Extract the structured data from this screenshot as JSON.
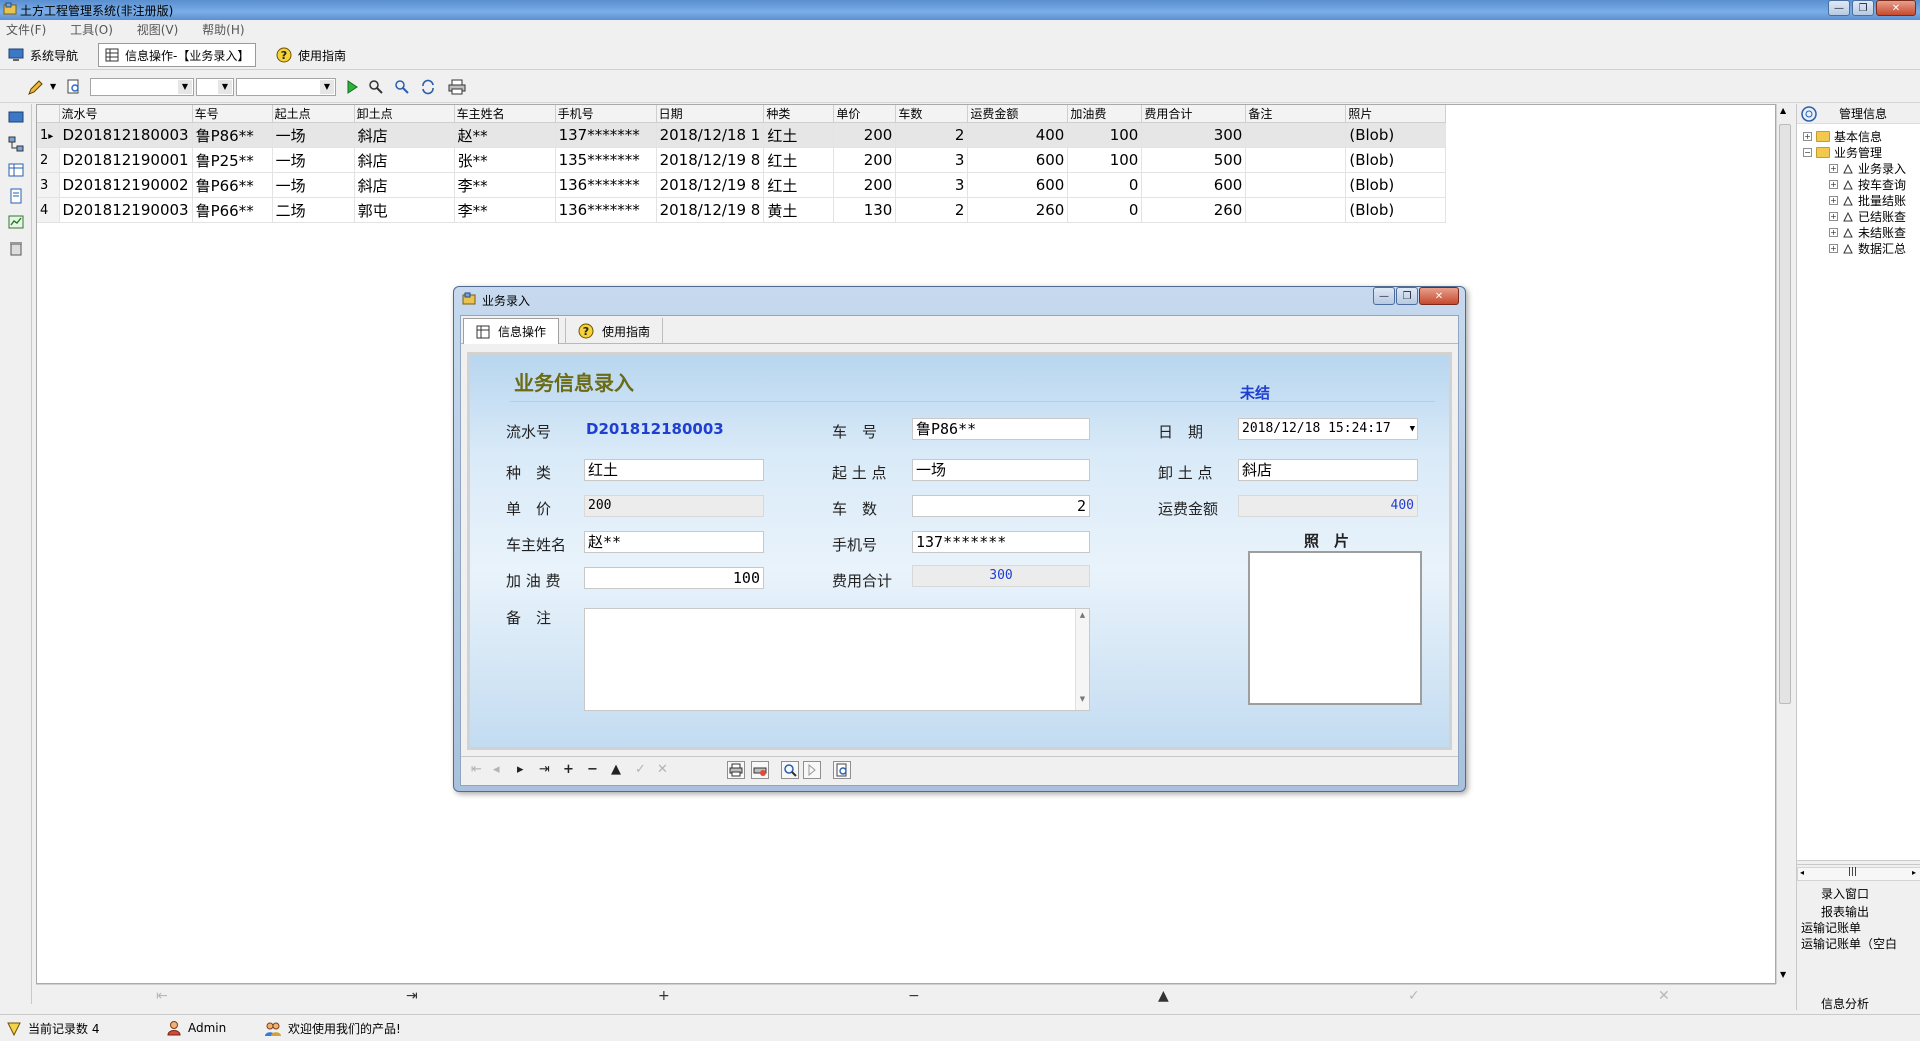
{
  "window": {
    "title": "土方工程管理系统(非注册版)",
    "controls": [
      "—",
      "❐",
      "✕"
    ]
  },
  "menu": [
    "文件(F)",
    "工具(O)",
    "视图(V)",
    "帮助(H)"
  ],
  "nav_tabs": [
    {
      "label": "系统导航",
      "icon": "monitor-icon"
    },
    {
      "label": "信息操作-【业务录入】",
      "icon": "grid-icon"
    },
    {
      "label": "使用指南",
      "icon": "help-icon"
    }
  ],
  "grid": {
    "columns": [
      "流水号",
      "车号",
      "起土点",
      "卸土点",
      "车主姓名",
      "手机号",
      "日期",
      "种类",
      "单价",
      "车数",
      "运费金额",
      "加油费",
      "费用合计",
      "备注",
      "照片"
    ],
    "rows": [
      {
        "idx": "1",
        "cells": [
          "D201812180003",
          "鲁P86**",
          "一场",
          "斜店",
          "赵**",
          "137*******",
          "2018/12/18 1",
          "红土",
          "200",
          "2",
          "400",
          "100",
          "300",
          "",
          "(Blob)"
        ]
      },
      {
        "idx": "2",
        "cells": [
          "D201812190001",
          "鲁P25**",
          "一场",
          "斜店",
          "张**",
          "135*******",
          "2018/12/19 8",
          "红土",
          "200",
          "3",
          "600",
          "100",
          "500",
          "",
          "(Blob)"
        ]
      },
      {
        "idx": "3",
        "cells": [
          "D201812190002",
          "鲁P66**",
          "一场",
          "斜店",
          "李**",
          "136*******",
          "2018/12/19 8",
          "红土",
          "200",
          "3",
          "600",
          "0",
          "600",
          "",
          "(Blob)"
        ]
      },
      {
        "idx": "4",
        "cells": [
          "D201812190003",
          "鲁P66**",
          "二场",
          "郭屯",
          "李**",
          "136*******",
          "2018/12/19 8",
          "黄土",
          "130",
          "2",
          "260",
          "0",
          "260",
          "",
          "(Blob)"
        ]
      }
    ],
    "selected_row": 0,
    "current_marker": "▸"
  },
  "grid_nav": [
    "⇤",
    "⇥",
    "+",
    "−",
    "▲",
    "✓",
    "✕"
  ],
  "right_panel": {
    "header": "管理信息",
    "tree": [
      {
        "label": "基本信息",
        "level": 0,
        "expander": "+",
        "kind": "folder"
      },
      {
        "label": "业务管理",
        "level": 0,
        "expander": "−",
        "kind": "folder"
      },
      {
        "label": "业务录入",
        "level": 1,
        "expander": "+",
        "kind": "doc"
      },
      {
        "label": "按车查询",
        "level": 1,
        "expander": "+",
        "kind": "doc"
      },
      {
        "label": "批量结账",
        "level": 1,
        "expander": "+",
        "kind": "doc"
      },
      {
        "label": "已结账查",
        "level": 1,
        "expander": "+",
        "kind": "doc"
      },
      {
        "label": "未结账查",
        "level": 1,
        "expander": "+",
        "kind": "doc"
      },
      {
        "label": "数据汇总",
        "level": 1,
        "expander": "+",
        "kind": "doc"
      }
    ],
    "lower": {
      "entry_window": "录入窗口",
      "report_output": "报表输出",
      "reports": [
        "运输记账单",
        "运输记账单（空白"
      ],
      "analysis": "信息分析",
      "hscroll": "|||"
    }
  },
  "statusbar": {
    "records": "当前记录数 4",
    "user": "Admin",
    "welcome": "欢迎使用我们的产品!"
  },
  "dialog": {
    "title": "业务录入",
    "tabs": [
      {
        "label": "信息操作",
        "icon": "grid-icon"
      },
      {
        "label": "使用指南",
        "icon": "help-icon"
      }
    ],
    "form": {
      "heading": "业务信息录入",
      "status": "未结",
      "labels": {
        "serial": "流水号",
        "plate": "车　号",
        "date": "日　期",
        "kind": "种　类",
        "start": "起 土 点",
        "unload": "卸 土 点",
        "price": "单　价",
        "trucks": "车　数",
        "freight": "运费金额",
        "owner": "车主姓名",
        "phone": "手机号",
        "photo": "照　片",
        "fuel": "加 油 费",
        "total": "费用合计",
        "memo": "备　注"
      },
      "values": {
        "serial": "D201812180003",
        "plate": "鲁P86**",
        "date": "2018/12/18 15:24:17",
        "kind": "红土",
        "start": "一场",
        "unload": "斜店",
        "price": "200",
        "trucks": "2",
        "freight": "400",
        "owner": "赵**",
        "phone": "137*******",
        "fuel": "100",
        "total": "300",
        "memo": ""
      }
    },
    "nav": [
      "⇤",
      "◂",
      "▸",
      "⇥",
      "+",
      "−",
      "▲",
      "✓",
      "✕"
    ]
  },
  "colors": {
    "accent_blue": "#1f3fd1",
    "heading_olive": "#6b6b16",
    "titlebar": "#6a9fdc"
  }
}
